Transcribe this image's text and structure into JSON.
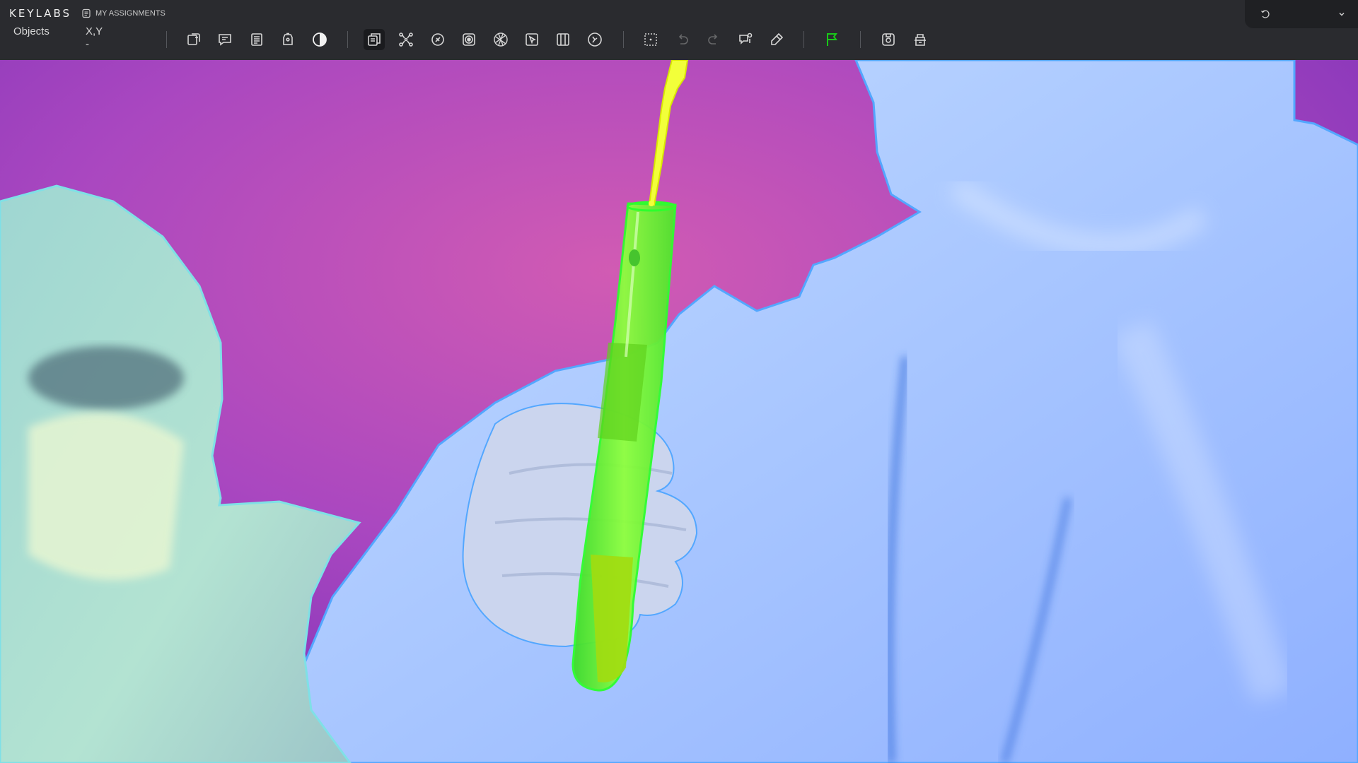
{
  "app": {
    "logo": "KEYLABS",
    "assignments_label": "MY ASSIGNMENTS"
  },
  "panel": {
    "objects_label": "Objects",
    "coords_label": "X,Y",
    "coords_value": "-"
  },
  "toolbar": {
    "tools": [
      {
        "name": "bounding-box-tool",
        "icon": "bbox-icon"
      },
      {
        "name": "comment-tool",
        "icon": "comment-icon"
      },
      {
        "name": "list-tool",
        "icon": "list-icon"
      },
      {
        "name": "tag-tool",
        "icon": "tag-icon"
      },
      {
        "name": "contrast-tool",
        "icon": "contrast-icon"
      },
      {
        "name": "polygon-copy-tool",
        "icon": "layers-icon",
        "active": true
      },
      {
        "name": "keypoints-tool",
        "icon": "keypoints-icon"
      },
      {
        "name": "brush-tool",
        "icon": "brush-icon"
      },
      {
        "name": "mask-tool",
        "icon": "mask-icon"
      },
      {
        "name": "mesh-tool",
        "icon": "mesh-icon"
      },
      {
        "name": "smart-select-tool",
        "icon": "cursor-box-icon"
      },
      {
        "name": "grid-tool",
        "icon": "grid-icon"
      },
      {
        "name": "auto-tool",
        "icon": "timer-icon"
      },
      {
        "name": "focus-tool",
        "icon": "focus-icon"
      },
      {
        "name": "undo",
        "icon": "undo-icon",
        "disabled": true
      },
      {
        "name": "redo",
        "icon": "redo-icon",
        "disabled": true
      },
      {
        "name": "review-tool",
        "icon": "review-icon"
      },
      {
        "name": "eraser-tool",
        "icon": "eraser-icon"
      },
      {
        "name": "flag-tool",
        "icon": "flag-icon"
      },
      {
        "name": "save-tool",
        "icon": "save-icon"
      },
      {
        "name": "submit-tool",
        "icon": "submit-icon"
      }
    ]
  },
  "colors": {
    "topbar_bg": "#2a2b2f",
    "flag_green": "#19c819",
    "mask_green": "#6cff2a",
    "mask_yellow": "#f2ff3a",
    "background_magenta": "#b43fb8",
    "suit_blue": "#a4c8ff"
  }
}
